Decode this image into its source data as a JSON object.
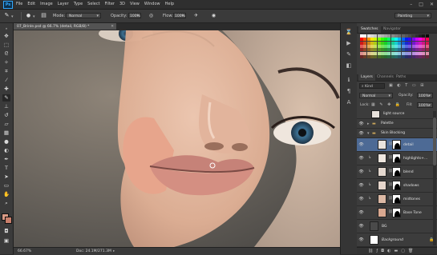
{
  "app": {
    "logo": "Ps",
    "menus": [
      "File",
      "Edit",
      "Image",
      "Layer",
      "Type",
      "Select",
      "Filter",
      "3D",
      "View",
      "Window",
      "Help"
    ]
  },
  "options_bar": {
    "mode_label": "Mode:",
    "mode_value": "Normal",
    "opacity_label": "Opacity:",
    "opacity_value": "100%",
    "flow_label": "Flow:",
    "flow_value": "100%",
    "workspace_value": "Painting"
  },
  "document": {
    "tab_title": "07_Brinle.psd @ 66.7% (detail, RGB/8) *",
    "zoom": "66.67%",
    "doc_size": "Doc: 24.1M/271.3M"
  },
  "swatches_panel": {
    "tabs": [
      "Swatches",
      "Navigator"
    ]
  },
  "layers_panel": {
    "tabs": [
      "Layers",
      "Channels",
      "Paths"
    ],
    "filter_kind": "Kind",
    "blend_mode": "Normal",
    "opacity_label": "Opacity:",
    "opacity_value": "100%",
    "lock_label": "Lock:",
    "fill_label": "Fill:",
    "fill_value": "100%",
    "top_partial_layer": "light source",
    "groups": [
      {
        "name": "Palette"
      },
      {
        "name": "Skin Blocking"
      }
    ],
    "layers": [
      {
        "name": "detail",
        "selected": true
      },
      {
        "name": "highlights+...",
        "selected": false
      },
      {
        "name": "blend",
        "selected": false
      },
      {
        "name": "shadows",
        "selected": false
      },
      {
        "name": "midtones",
        "selected": false
      },
      {
        "name": "Base Tone",
        "selected": false
      }
    ],
    "bottom_layers": [
      {
        "name": "BG"
      },
      {
        "name": "Background"
      }
    ]
  },
  "colors": {
    "selection": "#4d6a95",
    "foreground": "#d99a85",
    "background": "#c97f6b"
  }
}
